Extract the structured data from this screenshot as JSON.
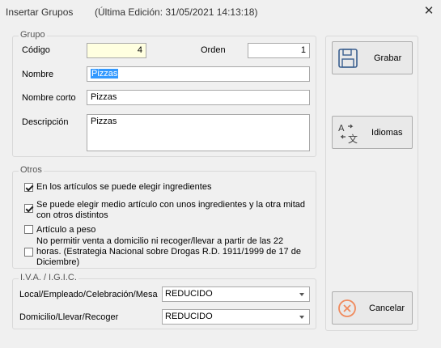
{
  "window": {
    "title": "Insertar Grupos",
    "subtitle": "(Última Edición: 31/05/2021 14:13:18)",
    "close_glyph": "✕"
  },
  "grupo": {
    "legend": "Grupo",
    "codigo_label": "Código",
    "codigo_value": "4",
    "orden_label": "Orden",
    "orden_value": "1",
    "nombre_label": "Nombre",
    "nombre_value": "Pizzas",
    "nombre_corto_label": "Nombre corto",
    "nombre_corto_value": "Pizzas",
    "descripcion_label": "Descripción",
    "descripcion_value": "Pizzas"
  },
  "otros": {
    "legend": "Otros",
    "options": [
      {
        "label": "En los artículos se puede elegir ingredientes",
        "checked": true
      },
      {
        "label": "Se puede elegir medio artículo con unos ingredientes y la otra mitad con otros distintos",
        "checked": true
      },
      {
        "label": "Artículo a peso",
        "checked": false
      },
      {
        "label": "No permitir venta a domicilio ni recoger/llevar a partir de las 22 horas. (Estrategia Nacional sobre Drogas R.D. 1911/1999 de 17 de Diciembre)",
        "checked": false
      }
    ]
  },
  "iva": {
    "legend": "I.V.A. / I.G.I.C.",
    "local_label": "Local/Empleado/Celebración/Mesa",
    "local_value": "REDUCIDO",
    "domicilio_label": "Domicilio/Llevar/Recoger",
    "domicilio_value": "REDUCIDO"
  },
  "buttons": {
    "grabar": "Grabar",
    "idiomas": "Idiomas",
    "cancelar": "Cancelar"
  },
  "icons": {
    "grabar": "floppy-disk-icon",
    "idiomas": "translate-icon",
    "cancelar": "cancel-circle-icon"
  },
  "colors": {
    "highlight": "#3399ff",
    "codigo_bg": "#ffffe0",
    "cancel_icon": "#f08a5d"
  }
}
